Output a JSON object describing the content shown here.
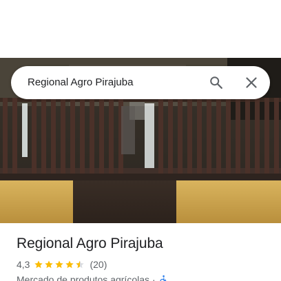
{
  "search": {
    "query": "Regional Agro Pirajuba",
    "search_icon": "search-icon",
    "close_icon": "close-icon"
  },
  "hero": {
    "photo": "storefront-photo"
  },
  "place": {
    "name": "Regional Agro Pirajuba",
    "rating": "4,3",
    "stars": 4.5,
    "reviews_count": "(20)",
    "category": "Mercado de produtos agrícolas",
    "separator": "·",
    "accessibility_icon": "wheelchair-icon"
  },
  "colors": {
    "star": "#fbbc04",
    "text_primary": "#202124",
    "text_secondary": "#5f6368",
    "icon": "#5f6368",
    "accessibility_blue": "#1a73e8"
  }
}
